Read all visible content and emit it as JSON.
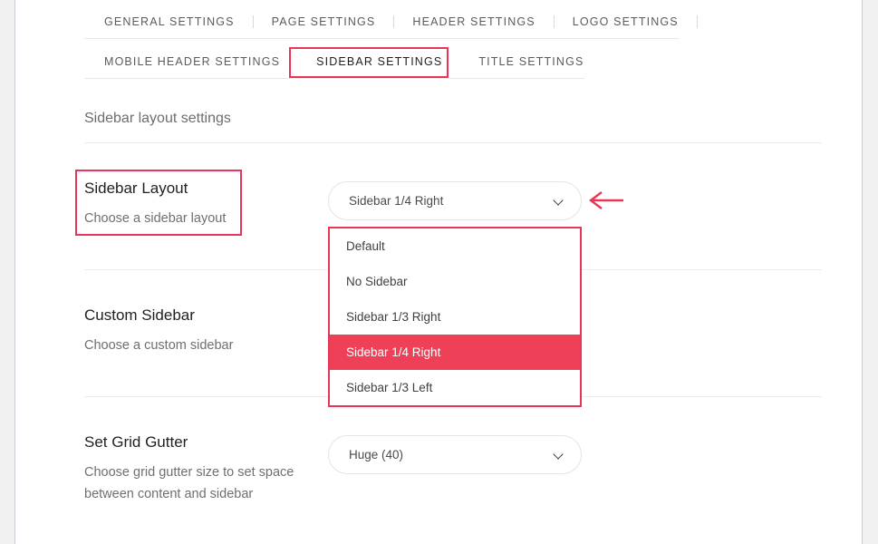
{
  "theme": {
    "accent": "#e8365a",
    "highlight_fill": "#ee4057",
    "panel_bg": "#ffffff",
    "page_bg": "#f1f1f1"
  },
  "tabs": {
    "row1": [
      {
        "label": "GENERAL SETTINGS",
        "active": false
      },
      {
        "label": "PAGE SETTINGS",
        "active": false
      },
      {
        "label": "HEADER SETTINGS",
        "active": false
      },
      {
        "label": "LOGO SETTINGS",
        "active": false
      }
    ],
    "row2": [
      {
        "label": "MOBILE HEADER SETTINGS",
        "active": false
      },
      {
        "label": "SIDEBAR SETTINGS",
        "active": true
      },
      {
        "label": "TITLE SETTINGS",
        "active": false
      }
    ]
  },
  "section": {
    "title": "Sidebar layout settings"
  },
  "settings": [
    {
      "title": "Sidebar Layout",
      "description": "Choose a sidebar layout",
      "control": {
        "type": "select",
        "value": "Sidebar 1/4 Right",
        "open": true,
        "options": [
          "Default",
          "No Sidebar",
          "Sidebar 1/3 Right",
          "Sidebar 1/4 Right",
          "Sidebar 1/3 Left"
        ],
        "selected_option": "Sidebar 1/4 Right"
      }
    },
    {
      "title": "Custom Sidebar",
      "description": "Choose a custom sidebar",
      "control": {
        "type": "select",
        "value": "",
        "open": false
      }
    },
    {
      "title": "Set Grid Gutter",
      "description": "Choose grid gutter size to set space between content and sidebar",
      "control": {
        "type": "select",
        "value": "Huge (40)",
        "open": false
      }
    }
  ],
  "annotations": {
    "tab_box": "SIDEBAR SETTINGS",
    "label_box": "Sidebar Layout",
    "arrow": "left-arrow-pointing-to-sidebar-layout-select"
  }
}
